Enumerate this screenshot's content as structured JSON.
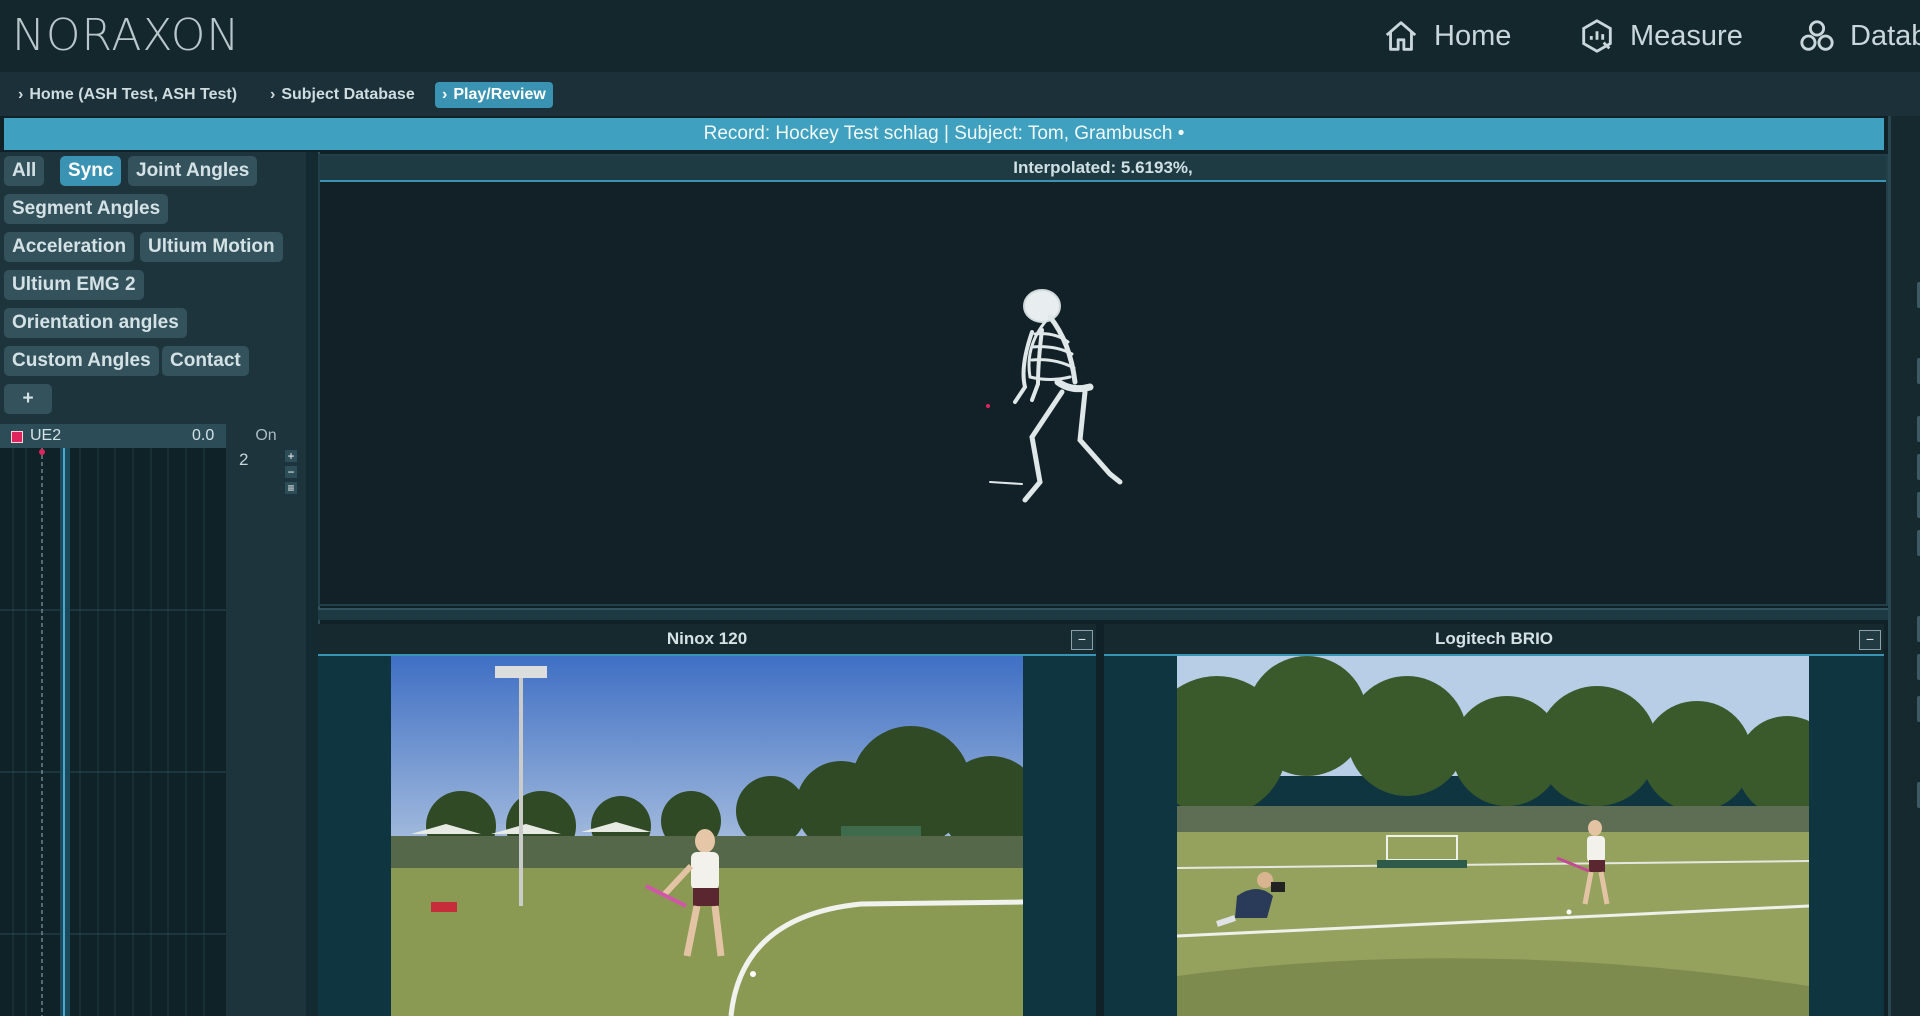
{
  "header": {
    "logo": "NORAXON",
    "nav": [
      {
        "label": "Home",
        "icon": "home-icon"
      },
      {
        "label": "Measure",
        "icon": "measure-icon"
      },
      {
        "label": "Datab",
        "icon": "database-icon"
      }
    ]
  },
  "breadcrumbs": [
    {
      "label": "Home (ASH Test, ASH Test)",
      "active": false
    },
    {
      "label": "Subject Database",
      "active": false
    },
    {
      "label": "Play/Review",
      "active": true
    }
  ],
  "record_bar": "Record: Hockey Test schlag | Subject: Tom, Grambusch •",
  "filters": {
    "items": [
      "All",
      "Sync",
      "Joint Angles",
      "Segment Angles",
      "Acceleration",
      "Ultium Motion",
      "Ultium EMG 2",
      "Orientation angles",
      "Custom Angles",
      "Contact",
      "+"
    ],
    "active": "Sync"
  },
  "channel": {
    "color": "#e0245e",
    "name": "UE2",
    "value": "0.0",
    "toggle": "On",
    "scale_value": "2",
    "plus": "+",
    "minus": "−",
    "menu": "≡"
  },
  "skeleton_view": {
    "title": "Interpolated: 5.6193%,"
  },
  "videos": [
    {
      "title": "Ninox 120",
      "minimize": "−"
    },
    {
      "title": "Logitech BRIO",
      "minimize": "−"
    }
  ],
  "colors": {
    "accent": "#3a93b2",
    "background": "#102228",
    "record_bar": "#3fa1bf"
  }
}
